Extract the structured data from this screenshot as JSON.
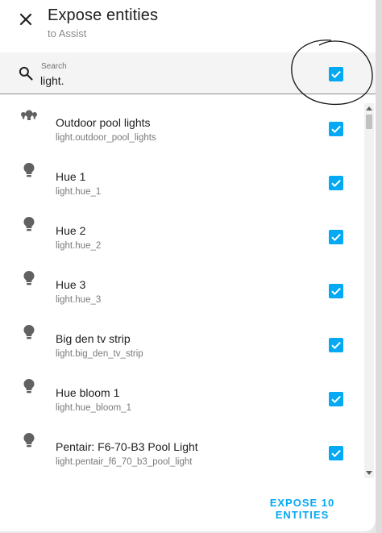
{
  "dialog": {
    "title": "Expose entities",
    "subtitle": "to Assist",
    "close_icon": "close-icon"
  },
  "search": {
    "label": "Search",
    "value": "light.",
    "icon": "search-icon",
    "select_all_checked": true
  },
  "entities": [
    {
      "name": "Outdoor pool lights",
      "id": "light.outdoor_pool_lights",
      "icon": "light-group-icon",
      "checked": true
    },
    {
      "name": "Hue 1",
      "id": "light.hue_1",
      "icon": "lightbulb-icon",
      "checked": true
    },
    {
      "name": "Hue 2",
      "id": "light.hue_2",
      "icon": "lightbulb-icon",
      "checked": true
    },
    {
      "name": "Hue 3",
      "id": "light.hue_3",
      "icon": "lightbulb-icon",
      "checked": true
    },
    {
      "name": "Big den tv strip",
      "id": "light.big_den_tv_strip",
      "icon": "lightbulb-icon",
      "checked": true
    },
    {
      "name": "Hue bloom 1",
      "id": "light.hue_bloom_1",
      "icon": "lightbulb-icon",
      "checked": true
    },
    {
      "name": "Pentair: F6-70-B3 Pool Light",
      "id": "light.pentair_f6_70_b3_pool_light",
      "icon": "lightbulb-icon",
      "checked": true
    }
  ],
  "footer": {
    "expose_button": "EXPOSE 10 ENTITIES"
  },
  "colors": {
    "accent": "#03a9f4",
    "icon_gray": "#616161",
    "annotation": "#111111"
  }
}
